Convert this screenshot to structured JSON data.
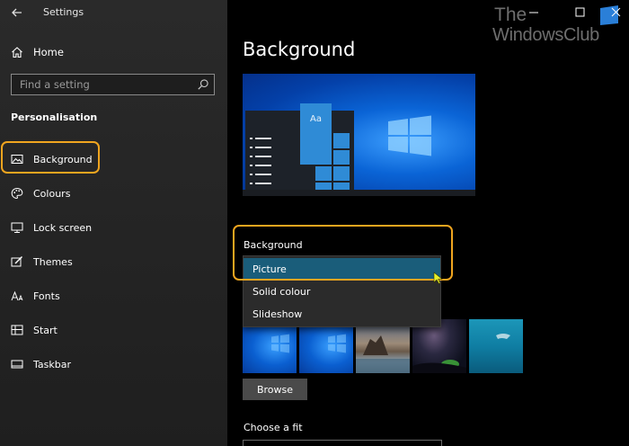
{
  "window": {
    "title": "Settings"
  },
  "watermark": {
    "line1": "The",
    "line2": "WindowsClub"
  },
  "sidebar": {
    "home_label": "Home",
    "search_placeholder": "Find a setting",
    "section_title": "Personalisation",
    "items": [
      {
        "label": "Background",
        "icon": "picture-icon",
        "selected": true
      },
      {
        "label": "Colours",
        "icon": "palette-icon"
      },
      {
        "label": "Lock screen",
        "icon": "lock-screen-icon"
      },
      {
        "label": "Themes",
        "icon": "brush-icon"
      },
      {
        "label": "Fonts",
        "icon": "font-icon"
      },
      {
        "label": "Start",
        "icon": "start-icon"
      },
      {
        "label": "Taskbar",
        "icon": "taskbar-icon"
      }
    ]
  },
  "main": {
    "page_title": "Background",
    "preview": {
      "tile_text": "Aa"
    },
    "background_label": "Background",
    "background_options": [
      {
        "label": "Picture",
        "selected": true
      },
      {
        "label": "Solid colour"
      },
      {
        "label": "Slideshow"
      }
    ],
    "browse_label": "Browse",
    "fit_label": "Choose a fit"
  },
  "colors": {
    "highlight": "#f0a51f",
    "selected_option": "#1a5d7a",
    "windows_blue": "#0a64d6"
  }
}
